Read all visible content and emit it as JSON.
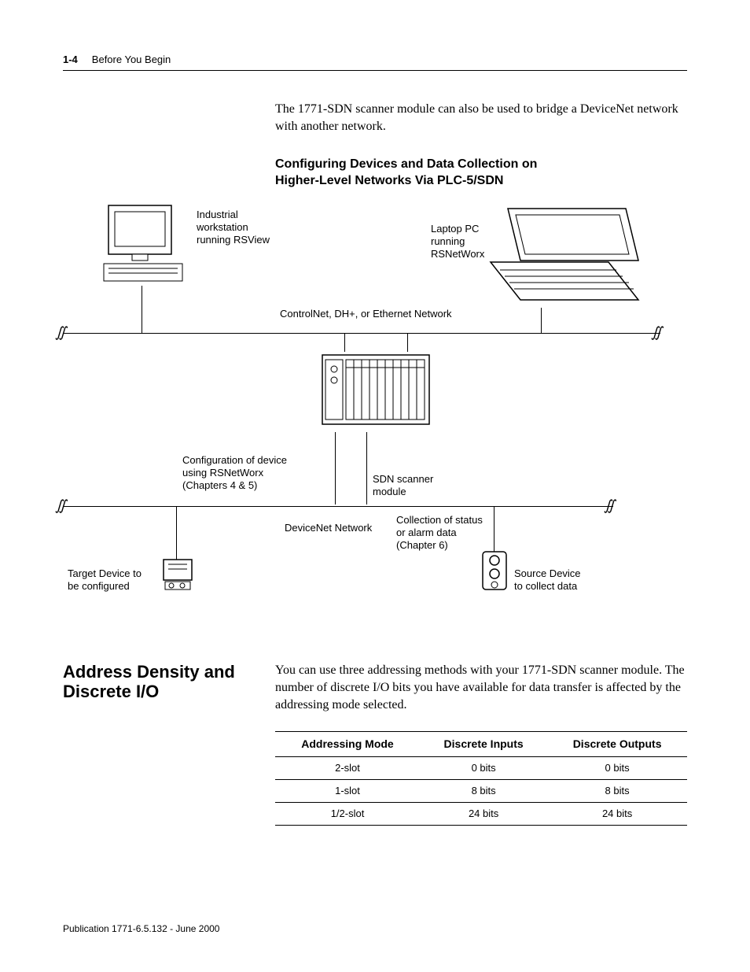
{
  "header": {
    "page_number": "1-4",
    "chapter_title": "Before You Begin"
  },
  "intro_paragraph": "The 1771-SDN scanner module can also be used to bridge a DeviceNet network with another network.",
  "figure": {
    "title_line1": "Configuring Devices and Data Collection on",
    "title_line2": "Higher-Level Networks Via PLC-5/SDN",
    "labels": {
      "workstation": "Industrial\nworkstation\nrunning RSView",
      "laptop": "Laptop PC\nrunning\nRSNetWorx",
      "net_upper": "ControlNet, DH+, or Ethernet Network",
      "config_note": "Configuration of device\nusing RSNetWorx\n(Chapters 4 & 5)",
      "sdn_module": "SDN scanner\nmodule",
      "net_lower": "DeviceNet Network",
      "status_note": "Collection of status\nor alarm data\n(Chapter 6)",
      "target_device": "Target Device to\nbe configured",
      "source_device": "Source Device\nto collect data"
    }
  },
  "section": {
    "heading": "Address Density and Discrete I/O",
    "body": "You can use three addressing methods with your 1771-SDN scanner module. The number of discrete I/O bits you have available for data transfer is affected by the addressing mode selected.",
    "table": {
      "headers": [
        "Addressing Mode",
        "Discrete Inputs",
        "Discrete Outputs"
      ],
      "rows": [
        [
          "2-slot",
          "0 bits",
          "0 bits"
        ],
        [
          "1-slot",
          "8 bits",
          "8 bits"
        ],
        [
          "1/2-slot",
          "24 bits",
          "24 bits"
        ]
      ]
    }
  },
  "footer": "Publication 1771-6.5.132 - June 2000",
  "chart_data": {
    "type": "table",
    "title": "Address Density and Discrete I/O",
    "columns": [
      "Addressing Mode",
      "Discrete Inputs",
      "Discrete Outputs"
    ],
    "rows": [
      {
        "Addressing Mode": "2-slot",
        "Discrete Inputs": "0 bits",
        "Discrete Outputs": "0 bits"
      },
      {
        "Addressing Mode": "1-slot",
        "Discrete Inputs": "8 bits",
        "Discrete Outputs": "8 bits"
      },
      {
        "Addressing Mode": "1/2-slot",
        "Discrete Inputs": "24 bits",
        "Discrete Outputs": "24 bits"
      }
    ]
  }
}
